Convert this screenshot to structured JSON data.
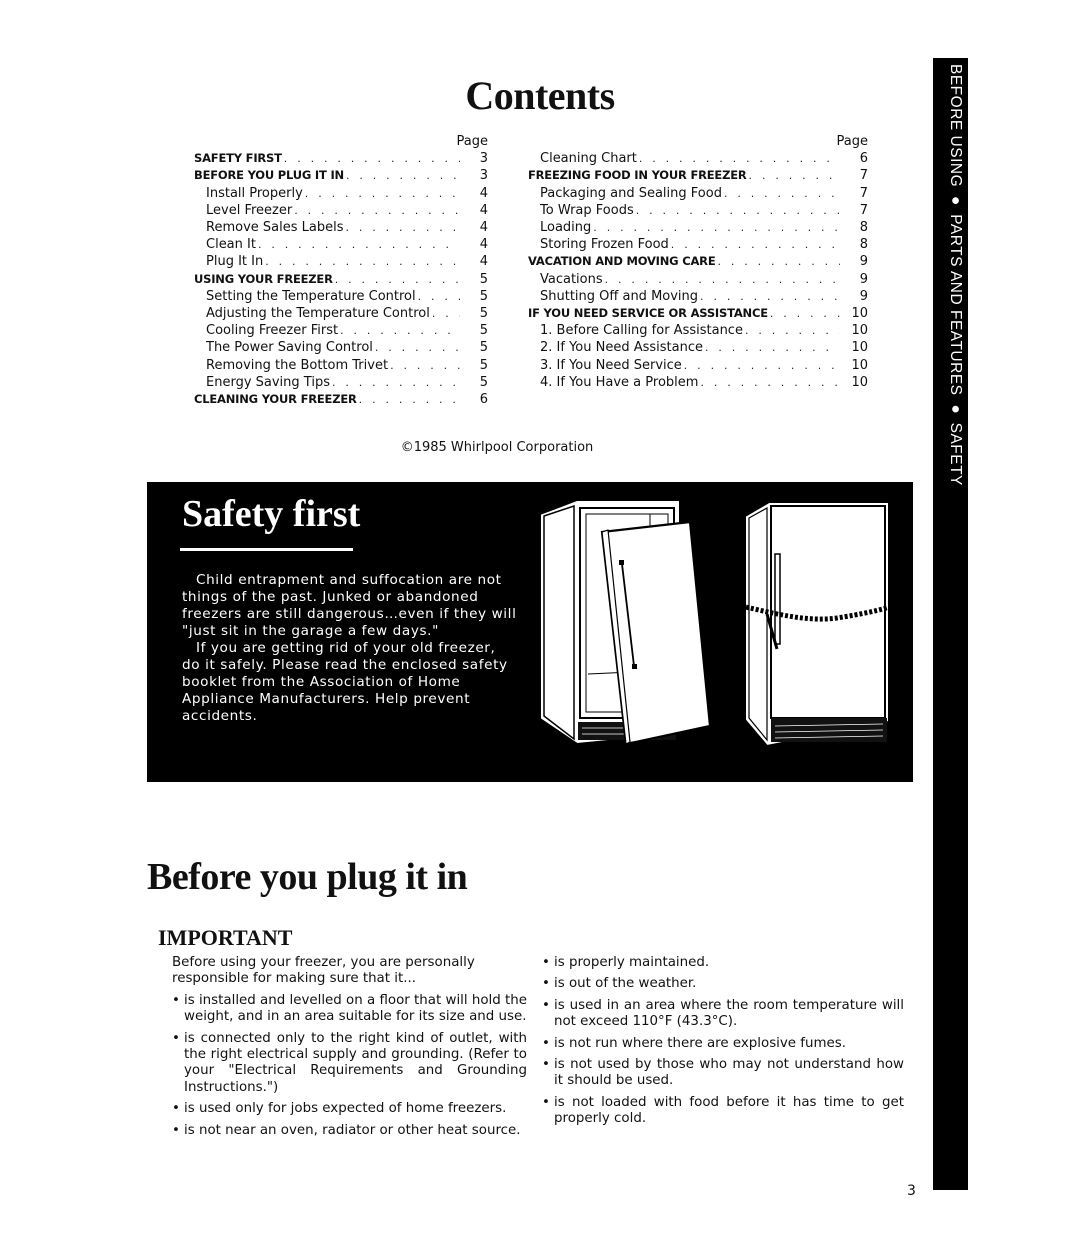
{
  "contents": {
    "title": "Contents",
    "page_header": "Page",
    "left": [
      {
        "label": "SAFETY FIRST",
        "page": "3",
        "type": "sec"
      },
      {
        "label": "BEFORE YOU PLUG IT IN",
        "page": "3",
        "type": "sec"
      },
      {
        "label": "Install Properly",
        "page": "4",
        "type": "sub"
      },
      {
        "label": "Level Freezer",
        "page": "4",
        "type": "sub"
      },
      {
        "label": "Remove Sales Labels",
        "page": "4",
        "type": "sub"
      },
      {
        "label": "Clean It",
        "page": "4",
        "type": "sub"
      },
      {
        "label": "Plug It In",
        "page": "4",
        "type": "sub"
      },
      {
        "label": "USING YOUR FREEZER",
        "page": "5",
        "type": "sec"
      },
      {
        "label": "Setting the Temperature Control",
        "page": "5",
        "type": "sub"
      },
      {
        "label": "Adjusting the Temperature Control",
        "page": "5",
        "type": "sub"
      },
      {
        "label": "Cooling Freezer First",
        "page": "5",
        "type": "sub"
      },
      {
        "label": "The Power Saving Control",
        "page": "5",
        "type": "sub"
      },
      {
        "label": "Removing the Bottom Trivet",
        "page": "5",
        "type": "sub"
      },
      {
        "label": "Energy Saving Tips",
        "page": "5",
        "type": "sub"
      },
      {
        "label": "CLEANING YOUR FREEZER",
        "page": "6",
        "type": "sec"
      }
    ],
    "right": [
      {
        "label": "Cleaning Chart",
        "page": "6",
        "type": "sub"
      },
      {
        "label": "FREEZING FOOD IN YOUR FREEZER",
        "page": "7",
        "type": "sec"
      },
      {
        "label": "Packaging and Sealing Food",
        "page": "7",
        "type": "sub"
      },
      {
        "label": "To Wrap Foods",
        "page": "7",
        "type": "sub"
      },
      {
        "label": "Loading",
        "page": "8",
        "type": "sub"
      },
      {
        "label": "Storing Frozen Food",
        "page": "8",
        "type": "sub"
      },
      {
        "label": "VACATION AND MOVING CARE",
        "page": "9",
        "type": "sec"
      },
      {
        "label": "Vacations",
        "page": "9",
        "type": "sub"
      },
      {
        "label": "Shutting Off and Moving",
        "page": "9",
        "type": "sub"
      },
      {
        "label": "IF YOU NEED SERVICE OR ASSISTANCE",
        "page": "10",
        "type": "sec"
      },
      {
        "label": "1. Before Calling for Assistance",
        "page": "10",
        "type": "sub"
      },
      {
        "label": "2. If You Need Assistance",
        "page": "10",
        "type": "sub"
      },
      {
        "label": "3. If You Need Service",
        "page": "10",
        "type": "sub"
      },
      {
        "label": "4. If You Have a Problem",
        "page": "10",
        "type": "sub"
      }
    ],
    "copyright": "©1985 Whirlpool Corporation"
  },
  "side_tab": {
    "text": "BEFORE USING ● PARTS AND FEATURES ● SAFETY"
  },
  "safety_first": {
    "title": "Safety first",
    "paragraphs": [
      "Child entrapment and suffocation are not things of the past. Junked or abandoned freezers are still dangerous…even if they will \"just sit in the garage a few days.\"",
      "If you are getting rid of your old freezer, do it safely. Please read the enclosed safety booklet from the Association of Home Appliance Manufacturers. Help prevent accidents."
    ],
    "illustrations": [
      "upright-freezer-door-removed-illustration",
      "upright-freezer-chained-illustration"
    ]
  },
  "before_plug": {
    "title": "Before you plug it in",
    "subtitle": "IMPORTANT",
    "intro": "Before using your freezer, you are personally responsible for making sure that it...",
    "left_bullets": [
      "is installed and levelled on a floor that will hold the weight, and in an area suitable for its size and use.",
      "is connected only to the right kind of outlet, with the right electrical supply and grounding. (Refer to your \"Electrical Requirements and Grounding Instructions.\")",
      "is used only for jobs expected of home freezers.",
      "is not near an oven, radiator or other heat source."
    ],
    "right_bullets": [
      "is properly maintained.",
      "is out of the weather.",
      "is used in an area where the room temperature will not exceed 110°F (43.3°C).",
      "is not run where there are explosive fumes.",
      "is not used by those who may not understand how it should be used.",
      "is not loaded with food before it has time to get properly cold."
    ],
    "bullet_glyph": "•"
  },
  "page_number": "3"
}
